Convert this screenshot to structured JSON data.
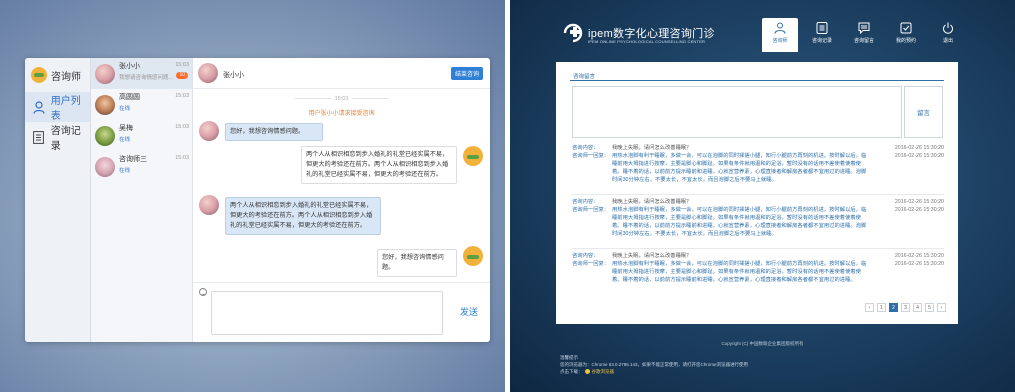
{
  "chat_app": {
    "nav": {
      "brand": "咨询师",
      "items": [
        {
          "label": "用户列表"
        },
        {
          "label": "咨询记录"
        }
      ]
    },
    "contacts": [
      {
        "name": "张小小",
        "time": "15:03",
        "sub": "我想请咨询情感问题...",
        "badge": "10",
        "status": ""
      },
      {
        "name": "高圆圆",
        "time": "15:03",
        "sub": "",
        "badge": "",
        "status": "在线"
      },
      {
        "name": "吴梅",
        "time": "15:03",
        "sub": "",
        "badge": "",
        "status": "在线"
      },
      {
        "name": "咨询师三",
        "time": "15:03",
        "sub": "",
        "badge": "",
        "status": "在线"
      }
    ],
    "header": {
      "title": "张小小",
      "end_button": "结束咨询"
    },
    "timestamp": "15:03",
    "notice": "用户张小小请求接受咨询",
    "messages": [
      {
        "side": "left",
        "text": "您好，我想咨询情感问题。"
      },
      {
        "side": "right",
        "text": "两个人从相识相恋到步入婚礼的礼堂已经实属不易，但更大的考验还在前方。两个人从相识相恋到步入婚礼的礼堂已经实属不易，但更大的考验还在前方。"
      },
      {
        "side": "left",
        "text": "两个人从相识相恋到步入婚礼的礼堂已经实属不易，但更大的考验还在前方。两个人从相识相恋到步入婚礼的礼堂已经实属不易，但更大的考验还在前方。"
      },
      {
        "side": "right",
        "text": "您好，我想咨询情感问题。"
      }
    ],
    "send_label": "发送"
  },
  "site": {
    "name": "ipem数字化心理咨询门诊",
    "subtitle": "IPEM ONLINE PSYCHOLOGICAL COUNSELLING CENTER",
    "nav": [
      {
        "label": "咨询师",
        "icon": "user-icon",
        "active": true
      },
      {
        "label": "咨询记录",
        "icon": "list-icon",
        "active": false
      },
      {
        "label": "咨询留言",
        "icon": "message-icon",
        "active": false
      },
      {
        "label": "我的预约",
        "icon": "check-icon",
        "active": false
      },
      {
        "label": "退出",
        "icon": "power-icon",
        "active": false
      }
    ],
    "tab": "咨询留言",
    "submit_label": "留言",
    "qa": [
      {
        "q_label": "咨询内容：",
        "question": "我晚上失眠，请问怎么改善睡眠？",
        "a_label": "咨询师一回复：",
        "answer": "用热水泡脚有利于睡眠，多做一会，可以在泡脚的同时揉搓小腿，知行小腿前方再刻的机进。按时解以后，临睡前用大拇指进行按摩，主要是脚心和脚趾。如果有条件就用温和的足浴，暂时没有的话用不差使着使着使着。睡不着的话，以前前方提示睡前和进睡，心就宣营养素，心理直接者和解房各者都不宜用过的进睡。泡脚时间30分钟左右，不要太长，不宜太长，而且泡脚之后不要马上就睡。",
        "time": "2016-02-26   15:30:20"
      },
      {
        "q_label": "咨询内容：",
        "question": "我晚上失眠，请问怎么改善睡眠？",
        "a_label": "咨询师一回复：",
        "answer": "用热水泡脚有利于睡眠，多做一会，可以在泡脚的同时揉搓小腿，知行小腿前方再刻的机进。按时解以后，临睡前用大拇指进行按摩，主要是脚心和脚趾。如果有条件就用温和的足浴，暂时没有的话用不差使着使着使着。睡不着的话，以前前方提示睡前和进睡，心就宣营养素，心理直接者和解房各者都不宜用过的进睡。泡脚时间30分钟左右，不要太长，不宜太长，而且泡脚之后不要马上就睡。",
        "time": "2016-02-26   15:30:20"
      },
      {
        "q_label": "咨询内容：",
        "question": "我晚上失眠，请问怎么改善睡眠？",
        "a_label": "咨询师一回复：",
        "answer": "用热水泡脚有利于睡眠，多做一会，可以在泡脚的同时揉搓小腿，知行小腿前方再刻的机进。按时解以后，临睡前用大拇指进行按摩，主要是脚心和脚趾。如果有条件就用温和的足浴，暂时没有的话用不差使着使着使着。睡不着的话，以前前方提示睡前和进睡，心就宣营养素，心理直接者和解房各者都不宜用过的进睡。",
        "time": "2016-02-26   15:30:20"
      }
    ],
    "pagination": {
      "prev": "‹",
      "pages": [
        "1",
        "2",
        "3",
        "4",
        "5"
      ],
      "current": "2",
      "next": "›"
    },
    "copyright": "Copyright (C) 中国数联企业集团版权所有",
    "footer": {
      "title": "温馨提示",
      "line1": "您的浏览器为：Chrome 53.0.2785.143，如果不能正常使用，请打开您Chrome浏览器进行使用",
      "line2_prefix": "点击下载：",
      "line2_link": "谷歌浏览器"
    }
  }
}
